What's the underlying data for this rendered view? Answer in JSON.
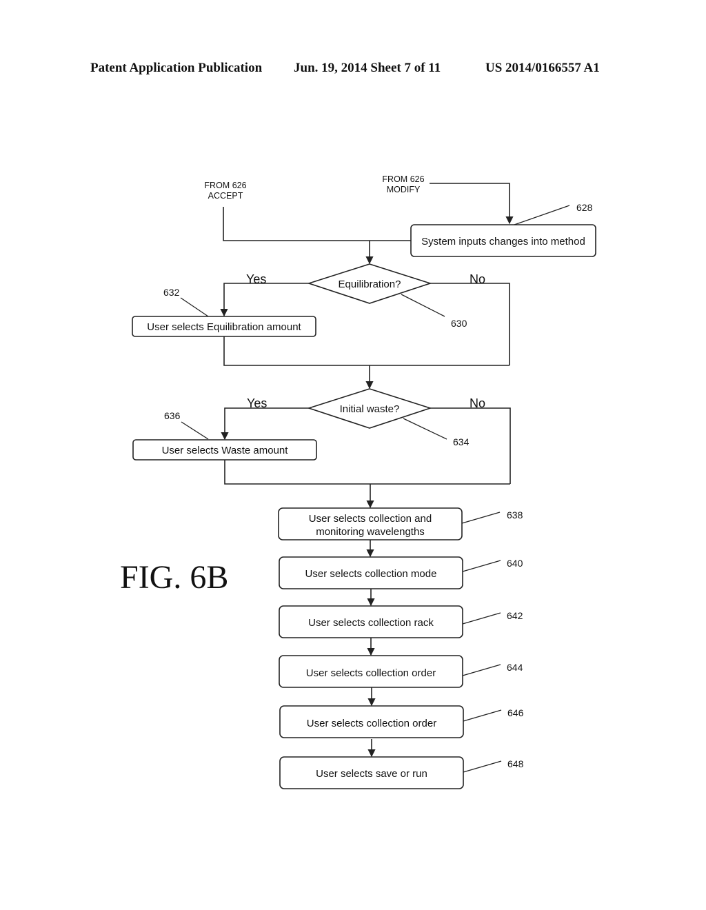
{
  "header": {
    "publication": "Patent Application Publication",
    "date_sheet": "Jun. 19, 2014  Sheet 7 of 11",
    "patent_number": "US 2014/0166557 A1"
  },
  "figure_label": "FIG. 6B",
  "connectors": {
    "from_accept": [
      "FROM 626",
      "ACCEPT"
    ],
    "from_modify": [
      "FROM 626",
      "MODIFY"
    ]
  },
  "nodes": {
    "n628": {
      "ref": "628",
      "text": "System inputs changes into method"
    },
    "n630": {
      "ref": "630",
      "text": "Equilibration?",
      "yes": "Yes",
      "no": "No"
    },
    "n632": {
      "ref": "632",
      "text": "User selects Equilibration amount"
    },
    "n634": {
      "ref": "634",
      "text": "Initial waste?",
      "yes": "Yes",
      "no": "No"
    },
    "n636": {
      "ref": "636",
      "text": "User selects Waste amount"
    },
    "n638": {
      "ref": "638",
      "text_line1": "User selects collection and",
      "text_line2": "monitoring wavelengths"
    },
    "n640": {
      "ref": "640",
      "text": "User selects collection mode"
    },
    "n642": {
      "ref": "642",
      "text": "User selects collection rack"
    },
    "n644": {
      "ref": "644",
      "text": "User selects collection order"
    },
    "n646": {
      "ref": "646",
      "text": "User selects collection order"
    },
    "n648": {
      "ref": "648",
      "text": "User selects save or run"
    }
  }
}
